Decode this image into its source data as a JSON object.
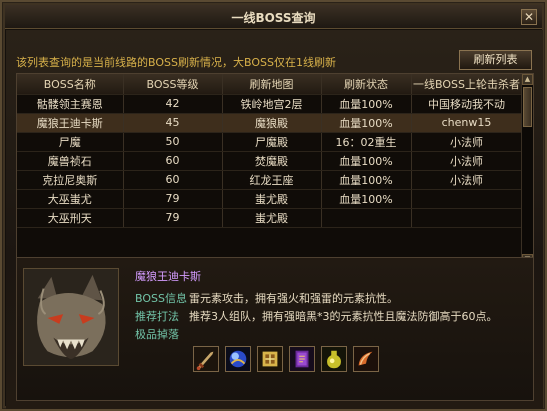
{
  "window": {
    "title": "一线BOSS查询",
    "close_glyph": "✕"
  },
  "description": "该列表查询的是当前线路的BOSS刷新情况，大BOSS仅在1线刷新",
  "refresh_label": "刷新列表",
  "table": {
    "headers": [
      "BOSS名称",
      "BOSS等级",
      "刷新地图",
      "刷新状态",
      "一线BOSS上轮击杀者"
    ],
    "rows": [
      [
        "骷髅领主赛恩",
        "42",
        "铁岭地宫2层",
        "血量100%",
        "中国移动我不动"
      ],
      [
        "魔狼王迪卡斯",
        "45",
        "魔狼殿",
        "血量100%",
        "chenw15"
      ],
      [
        "尸魔",
        "50",
        "尸魔殿",
        "16：02重生",
        "小法师"
      ],
      [
        "魔兽祯石",
        "60",
        "焚魔殿",
        "血量100%",
        "小法师"
      ],
      [
        "克拉尼奥斯",
        "60",
        "红龙王座",
        "血量100%",
        "小法师"
      ],
      [
        "大巫蚩尤",
        "79",
        "蚩尤殿",
        "血量100%",
        ""
      ],
      [
        "大巫刑天",
        "79",
        "蚩尤殿",
        "",
        ""
      ]
    ],
    "selected_row": 1
  },
  "scrollbar": {
    "up_glyph": "▲",
    "down_glyph": "▼"
  },
  "detail": {
    "boss_name": "魔狼王迪卡斯",
    "info_label": "BOSS信息",
    "info_value": "雷元素攻击，拥有强火和强雷的元素抗性。",
    "tactic_label": "推荐打法",
    "tactic_value": "推荐3人组队，拥有强暗黑*3的元素抗性且魔法防御高于60点。",
    "drops_label": "极品掉落",
    "drops": [
      "sword-icon",
      "orb-icon",
      "scroll-icon",
      "book-icon",
      "potion-icon",
      "horn-icon"
    ]
  },
  "colors": {
    "accent_gold": "#d8b14a",
    "name_purple": "#d49cff",
    "label_teal": "#72c4a8"
  }
}
